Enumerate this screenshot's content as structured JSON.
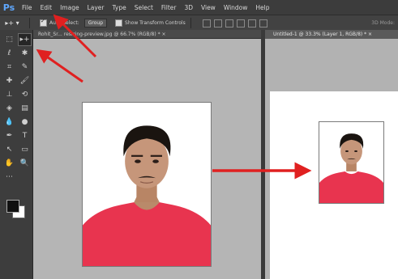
{
  "app": {
    "logo": "Ps"
  },
  "menu": [
    "File",
    "Edit",
    "Image",
    "Layer",
    "Type",
    "Select",
    "Filter",
    "3D",
    "View",
    "Window",
    "Help"
  ],
  "options": {
    "tool_glyph": "▸+ ▾",
    "auto_select_label": "Auto-Select:",
    "auto_select_value": "Group",
    "show_transform_label": "Show Transform Controls",
    "mode_3d": "3D Mode:"
  },
  "tabs": {
    "doc1": "Rohit_Sr... resizing-preview.jpg @ 66.7% (RGB/8) * ×",
    "doc2": "Untitled-1 @ 33.3% (Layer 1, RGB/8) * ×"
  },
  "tools": [
    {
      "glyph": "⬚",
      "icon": "marquee-icon"
    },
    {
      "glyph": "▸+",
      "icon": "move-icon",
      "active": true
    },
    {
      "glyph": "ℓ",
      "icon": "lasso-icon"
    },
    {
      "glyph": "✱",
      "icon": "quick-select-icon"
    },
    {
      "glyph": "⌗",
      "icon": "crop-icon"
    },
    {
      "glyph": "✎",
      "icon": "eyedropper-icon"
    },
    {
      "glyph": "✚",
      "icon": "healing-brush-icon"
    },
    {
      "glyph": "🖌",
      "icon": "brush-icon"
    },
    {
      "glyph": "⊥",
      "icon": "clone-stamp-icon"
    },
    {
      "glyph": "⟲",
      "icon": "history-brush-icon"
    },
    {
      "glyph": "◈",
      "icon": "eraser-icon"
    },
    {
      "glyph": "▤",
      "icon": "gradient-icon"
    },
    {
      "glyph": "💧",
      "icon": "blur-icon"
    },
    {
      "glyph": "●",
      "icon": "dodge-icon"
    },
    {
      "glyph": "✒",
      "icon": "pen-icon"
    },
    {
      "glyph": "T",
      "icon": "type-icon"
    },
    {
      "glyph": "↖",
      "icon": "path-select-icon"
    },
    {
      "glyph": "▭",
      "icon": "rectangle-icon"
    },
    {
      "glyph": "✋",
      "icon": "hand-icon"
    },
    {
      "glyph": "🔍",
      "icon": "zoom-icon"
    },
    {
      "glyph": "⋯",
      "icon": "more-tools-icon"
    },
    {
      "glyph": "",
      "icon": "blank-icon"
    }
  ],
  "colors": {
    "foreground": "#111111",
    "background": "#ffffff",
    "arrow": "#e02020",
    "shirt": "#e8344f"
  }
}
